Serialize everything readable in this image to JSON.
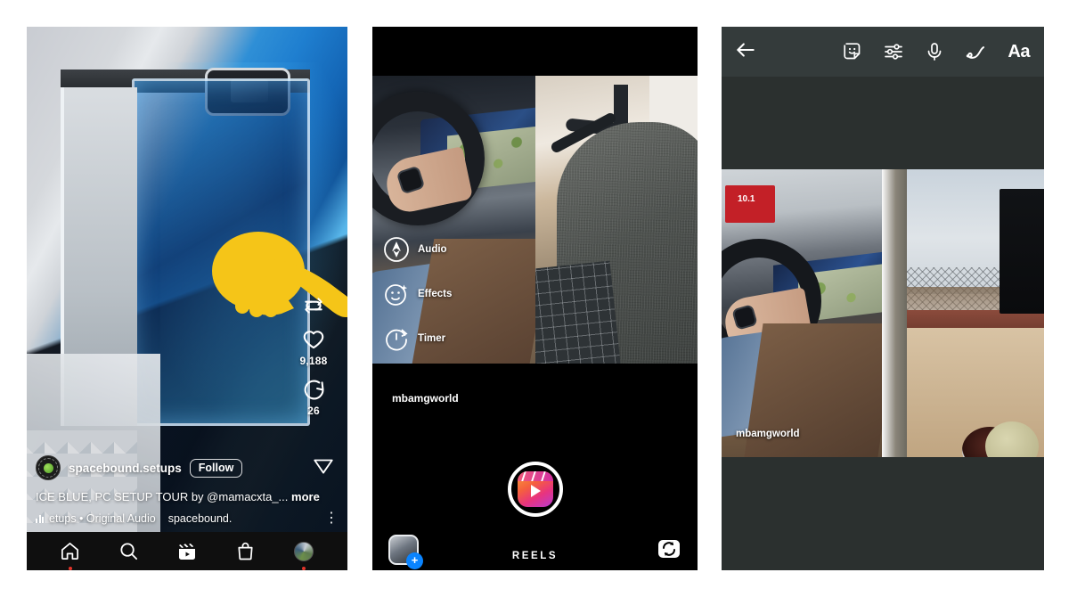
{
  "layout": {
    "background": "#ffffff",
    "panel_count": 3
  },
  "panel1": {
    "name": "instagram-reels-feed",
    "account": {
      "username": "spacebound.setups",
      "follow_label": "Follow",
      "avatar": "profile-avatar"
    },
    "caption": "ICE BLUE, PC SETUP TOUR by @mamacxta_...",
    "caption_more": "more",
    "audio": {
      "track": "etups • Original Audio",
      "extra": "spacebound."
    },
    "actions": {
      "remix": {
        "icon": "remix-arrows-icon",
        "count": ""
      },
      "like": {
        "icon": "heart-icon",
        "count": "9,188"
      },
      "comment": {
        "icon": "comment-bubble-icon",
        "count": "26"
      },
      "share": {
        "icon": "send-paperplane-icon"
      },
      "menu": {
        "icon": "more-vertical-icon"
      }
    },
    "overlay": {
      "icon": "pointing-hand-emoji",
      "color": "#f7c92b"
    },
    "bottom_nav": [
      {
        "name": "home",
        "icon": "home-icon",
        "badge": true
      },
      {
        "name": "search",
        "icon": "search-icon",
        "badge": false
      },
      {
        "name": "reels",
        "icon": "reels-icon",
        "badge": false
      },
      {
        "name": "shop",
        "icon": "shopping-bag-icon",
        "badge": false
      },
      {
        "name": "profile",
        "icon": "profile-avatar-icon",
        "badge": true
      }
    ]
  },
  "panel2": {
    "name": "instagram-reels-camera",
    "tools": [
      {
        "label": "Audio",
        "icon": "music-note-circle-icon"
      },
      {
        "label": "Effects",
        "icon": "effects-smiley-sparkle-icon"
      },
      {
        "label": "Timer",
        "icon": "timer-clock-icon"
      }
    ],
    "video_watermark": "mbamgworld",
    "mode_label": "REELS",
    "shutter": {
      "icon": "reels-shutter-icon"
    },
    "gallery": {
      "icon": "gallery-thumbnail-icon",
      "badge": "+"
    },
    "flip_camera": {
      "icon": "flip-camera-icon"
    }
  },
  "panel3": {
    "name": "instagram-story-editor",
    "toolbar": {
      "back": {
        "icon": "back-arrow-icon"
      },
      "items": [
        {
          "name": "sticker",
          "icon": "sticker-smiley-icon",
          "label": ""
        },
        {
          "name": "settings",
          "icon": "sliders-icon",
          "label": ""
        },
        {
          "name": "voice",
          "icon": "microphone-icon",
          "label": ""
        },
        {
          "name": "draw",
          "icon": "draw-squiggle-icon",
          "label": ""
        },
        {
          "name": "text",
          "icon": "text-aa-icon",
          "label": "Aa"
        }
      ]
    },
    "video_watermark": "mbamgworld",
    "background_color": "#2b302f",
    "topbar_color": "#343b3b"
  }
}
